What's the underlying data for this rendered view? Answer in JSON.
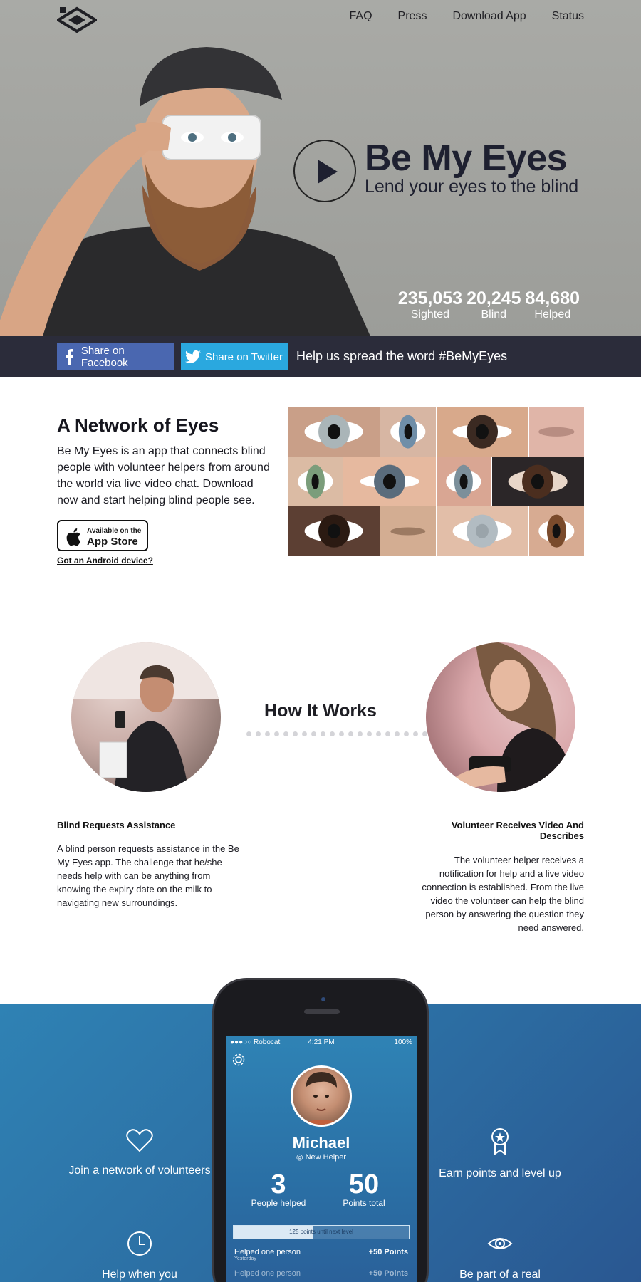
{
  "nav": {
    "items": [
      "FAQ",
      "Press",
      "Download App",
      "Status"
    ]
  },
  "hero": {
    "title": "Be My Eyes",
    "subtitle": "Lend your eyes to the blind",
    "stats": [
      {
        "value": "235,053",
        "label": "Sighted"
      },
      {
        "value": "20,245",
        "label": "Blind"
      },
      {
        "value": "84,680",
        "label": "Helped"
      }
    ]
  },
  "share": {
    "facebook": "Share on Facebook",
    "twitter": "Share on Twitter",
    "message": "Help us spread the word #BeMyEyes"
  },
  "network": {
    "title": "A Network of Eyes",
    "body": "Be My Eyes is an app that connects blind people with volunteer helpers from around the world via live video chat. Download now and start helping blind people see.",
    "appstore_small": "Available on the",
    "appstore_big": "App Store",
    "android": "Got an Android device?"
  },
  "how": {
    "title": "How It Works",
    "steps": [
      {
        "title": "Blind Requests Assistance",
        "body": "A blind person requests assistance in the Be My Eyes app. The challenge that he/she needs help with can be anything from knowing the expiry date on the milk to navigating new surroundings."
      },
      {
        "title": "Volunteer Receives Video And Describes",
        "body": "The volunteer helper receives a notification for help and a live video connection is established. From the live video the volunteer can help the blind person by answering the question they need answered."
      }
    ]
  },
  "features": {
    "items": [
      {
        "label": "Join a network of volunteers",
        "icon": "heart-icon"
      },
      {
        "label": "Earn points and level up",
        "icon": "award-icon"
      },
      {
        "label": "Help when you",
        "icon": "clock-icon"
      },
      {
        "label": "Be part of a real",
        "icon": "eye-icon"
      }
    ]
  },
  "phone": {
    "carrier": "●●●○○ Robocat",
    "time": "4:21 PM",
    "battery": "100%",
    "user_name": "Michael",
    "user_level": "New Helper",
    "people_helped_value": "3",
    "people_helped_label": "People helped",
    "points_value": "50",
    "points_label": "Points total",
    "progress_text": "125 points until next level",
    "progress_fraction": 0.45,
    "history": [
      {
        "label": "Helped one person",
        "sub": "Yesterday",
        "points": "+50 Points"
      },
      {
        "label": "Helped one person",
        "sub": "",
        "points": "+50 Points"
      }
    ]
  },
  "colors": {
    "share_bar": "#2b2c3a",
    "facebook": "#4a67b0",
    "twitter": "#2aa8df",
    "features_bg": "#2c6ea3"
  }
}
